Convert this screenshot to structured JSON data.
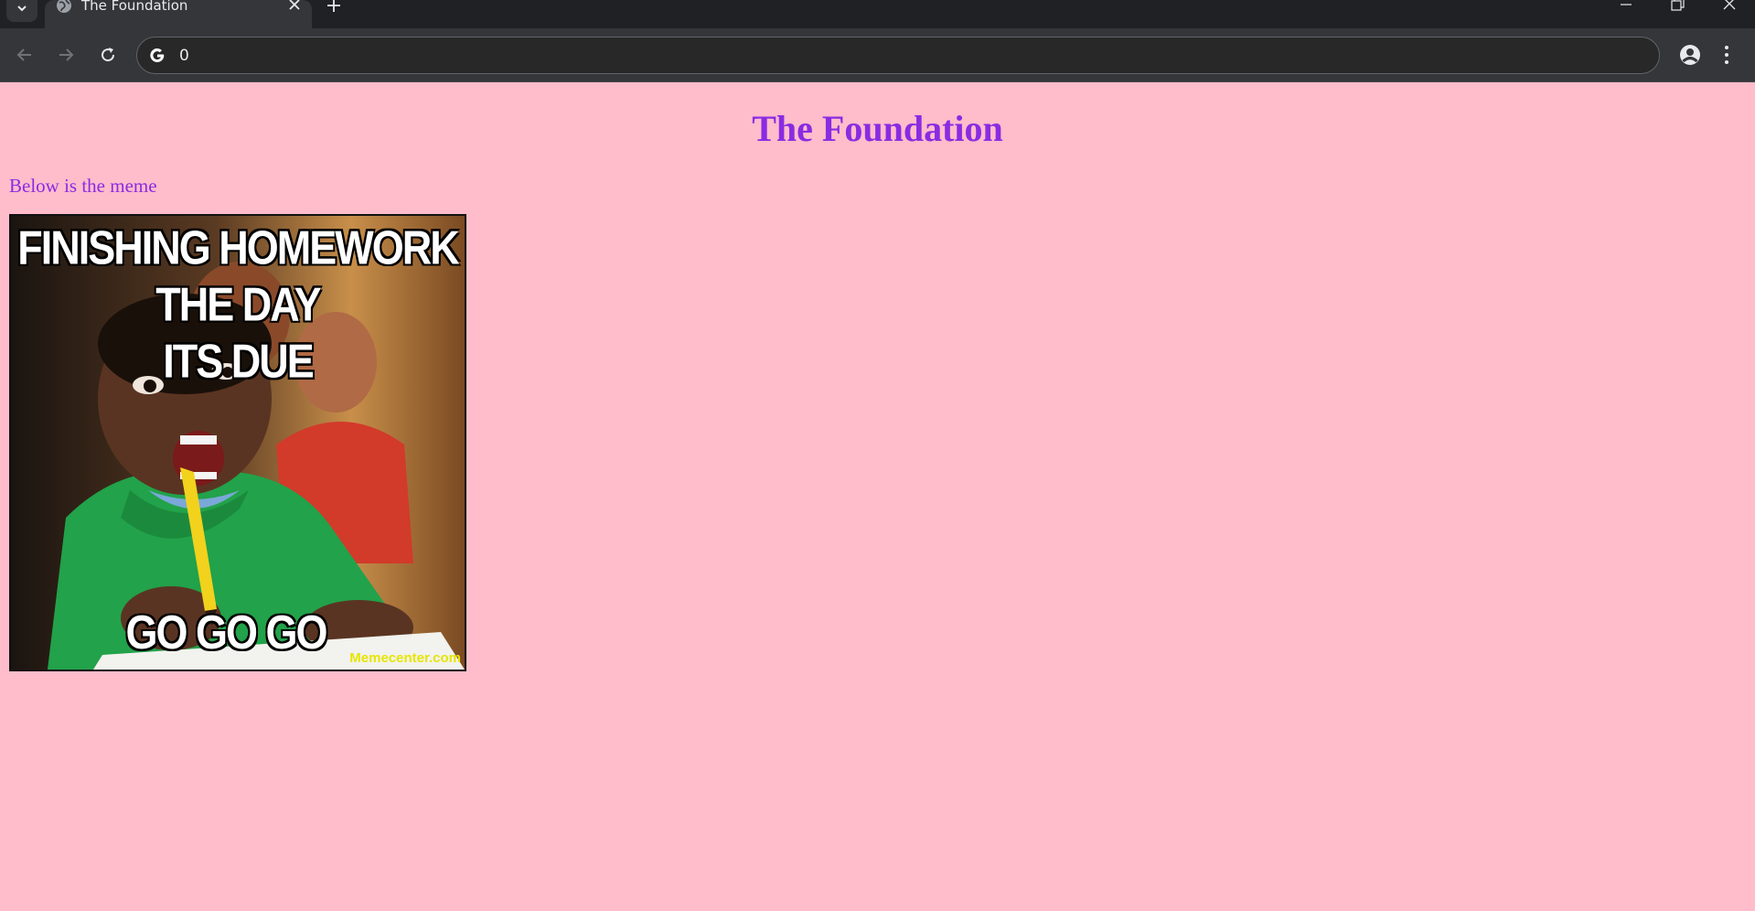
{
  "browser": {
    "tab_title": "The Foundation",
    "address": "0"
  },
  "page": {
    "title": "The Foundation",
    "intro": "Below is the meme",
    "meme": {
      "top_caption": "FINISHING HOMEWORK THE DAY\nITS DUE",
      "bottom_caption": "GO GO GO",
      "watermark": "Memecenter.com"
    }
  },
  "colors": {
    "page_background": "#FFBCCB",
    "heading_text": "#8A2BE2",
    "chrome_dark": "#202124",
    "chrome_toolbar": "#35363a"
  },
  "icons": {
    "tab_search": "chevron-down-icon",
    "favicon": "globe-icon",
    "tab_close": "close-icon",
    "new_tab": "plus-icon",
    "back": "arrow-left-icon",
    "forward": "arrow-right-icon",
    "reload": "reload-icon",
    "omnibox": "google-g-icon",
    "profile": "account-icon",
    "menu": "more-vert-icon",
    "minimize": "minimize-icon",
    "restore": "restore-icon",
    "close_window": "close-window-icon"
  }
}
